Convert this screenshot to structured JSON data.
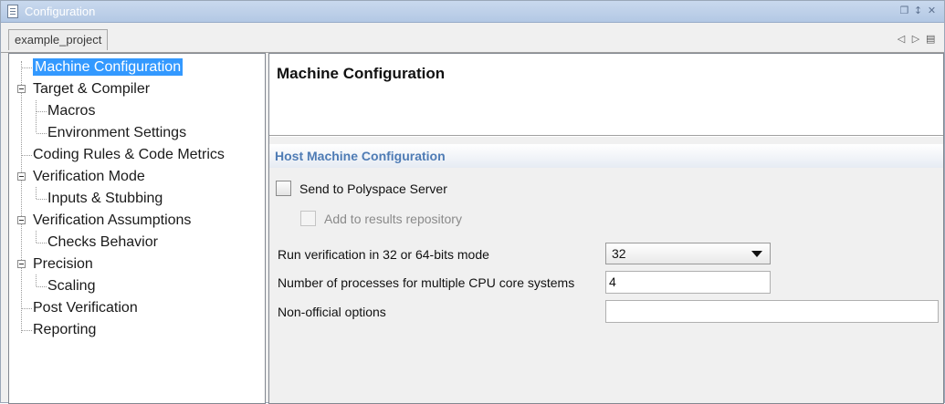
{
  "window": {
    "title": "Configuration",
    "controls": [
      "restore-icon",
      "pin-icon",
      "close-icon"
    ]
  },
  "tabs": {
    "active_label": "example_project",
    "nav": [
      "prev-tab-icon",
      "next-tab-icon",
      "tab-list-icon"
    ]
  },
  "tree": {
    "items": [
      {
        "label": "Machine Configuration",
        "level": 0,
        "expandable": false,
        "selected": true
      },
      {
        "label": "Target & Compiler",
        "level": 0,
        "expandable": true,
        "selected": false
      },
      {
        "label": "Macros",
        "level": 1,
        "expandable": false,
        "selected": false
      },
      {
        "label": "Environment Settings",
        "level": 1,
        "expandable": false,
        "selected": false
      },
      {
        "label": "Coding Rules & Code Metrics",
        "level": 0,
        "expandable": false,
        "selected": false
      },
      {
        "label": "Verification Mode",
        "level": 0,
        "expandable": true,
        "selected": false
      },
      {
        "label": "Inputs & Stubbing",
        "level": 1,
        "expandable": false,
        "selected": false
      },
      {
        "label": "Verification Assumptions",
        "level": 0,
        "expandable": true,
        "selected": false
      },
      {
        "label": "Checks Behavior",
        "level": 1,
        "expandable": false,
        "selected": false
      },
      {
        "label": "Precision",
        "level": 0,
        "expandable": true,
        "selected": false
      },
      {
        "label": "Scaling",
        "level": 1,
        "expandable": false,
        "selected": false
      },
      {
        "label": "Post Verification",
        "level": 0,
        "expandable": false,
        "selected": false
      },
      {
        "label": "Reporting",
        "level": 0,
        "expandable": false,
        "selected": false
      }
    ]
  },
  "page": {
    "title": "Machine Configuration",
    "section_title": "Host Machine Configuration",
    "send_to_server": {
      "label": "Send to Polyspace Server",
      "checked": false
    },
    "add_to_repository": {
      "label": "Add to results repository",
      "checked": false,
      "enabled": false
    },
    "bits_mode": {
      "label": "Run verification in 32 or 64-bits mode",
      "value": "32"
    },
    "processes": {
      "label": "Number of processes for multiple CPU core systems",
      "value": "4"
    },
    "non_official": {
      "label": "Non-official options",
      "value": ""
    }
  },
  "colors": {
    "selection": "#3399ff",
    "section_title": "#4f7cb5",
    "titlebar": "#b3c8e4"
  }
}
